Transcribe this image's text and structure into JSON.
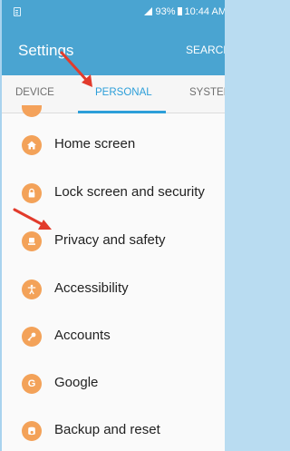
{
  "statusbar": {
    "battery": "93%",
    "time": "10:44 AM"
  },
  "appbar": {
    "title": "Settings",
    "search_label": "SEARCH"
  },
  "tabs": [
    {
      "label": "DEVICE",
      "selected": false
    },
    {
      "label": "PERSONAL",
      "selected": true
    },
    {
      "label": "SYSTEM",
      "selected": false
    }
  ],
  "list_items": [
    {
      "label": "Home screen",
      "icon": "home-icon"
    },
    {
      "label": "Lock screen and security",
      "icon": "lock-icon"
    },
    {
      "label": "Privacy and safety",
      "icon": "privacy-icon"
    },
    {
      "label": "Accessibility",
      "icon": "accessibility-icon"
    },
    {
      "label": "Accounts",
      "icon": "key-icon"
    },
    {
      "label": "Google",
      "icon": "google-icon",
      "glyph": "G"
    },
    {
      "label": "Backup and reset",
      "icon": "backup-icon"
    }
  ],
  "colors": {
    "accent": "#2d9fd9",
    "appbar": "#4aa4d1",
    "icon_bg": "#f3a259",
    "annotation_arrow": "#e23b2c"
  }
}
